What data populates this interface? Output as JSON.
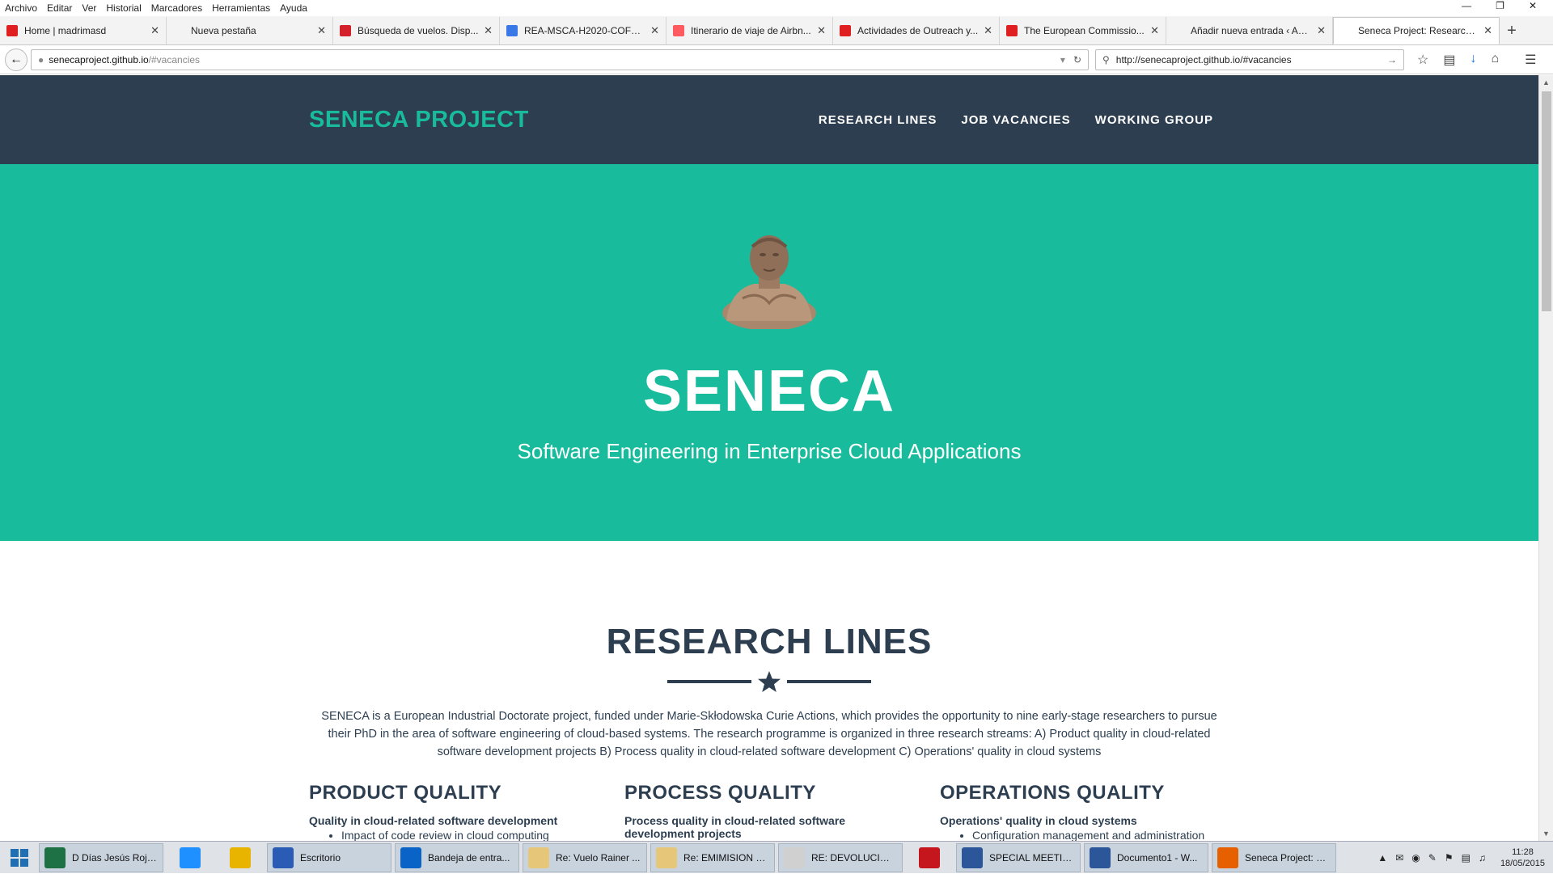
{
  "menu": [
    "Archivo",
    "Editar",
    "Ver",
    "Historial",
    "Marcadores",
    "Herramientas",
    "Ayuda"
  ],
  "tabs": [
    {
      "title": "Home | madrimasd",
      "icon": "madrimasd-icon",
      "color": "#e02020"
    },
    {
      "title": "Nueva pestaña",
      "icon": "blank-icon",
      "color": "#f3f3f3"
    },
    {
      "title": "Búsqueda de vuelos. Disp...",
      "icon": "iberia-icon",
      "color": "#d4202a"
    },
    {
      "title": "REA-MSCA-H2020-COFU...",
      "icon": "google-icon",
      "color": "#3b78e7"
    },
    {
      "title": "Itinerario de viaje de Airbn...",
      "icon": "airbnb-icon",
      "color": "#ff5a5f"
    },
    {
      "title": "Actividades de Outreach y...",
      "icon": "madrimasd-icon",
      "color": "#e02020"
    },
    {
      "title": "The European Commissio...",
      "icon": "madrimasd-icon",
      "color": "#e02020"
    },
    {
      "title": "Añadir nueva entrada ‹ Accion...",
      "icon": "blank-icon",
      "color": "#f3f3f3"
    },
    {
      "title": "Seneca Project: Research on Cl...",
      "icon": "blank-icon",
      "color": "#ffffff",
      "active": true
    }
  ],
  "address": {
    "host": "senecaproject.github.io",
    "path": "/#vacancies"
  },
  "search": {
    "value": "http://senecaproject.github.io/#vacancies"
  },
  "site": {
    "brand": "SENECA PROJECT",
    "nav": [
      "RESEARCH LINES",
      "JOB VACANCIES",
      "WORKING GROUP"
    ],
    "hero_title": "SENECA",
    "hero_subtitle": "Software Engineering in Enterprise Cloud Applications",
    "research_title": "RESEARCH LINES",
    "intro": "SENECA is a European Industrial Doctorate project, funded under Marie-Skłodowska Curie Actions, which provides the opportunity to nine early-stage researchers to pursue their PhD in the area of software engineering of cloud-based systems. The research programme is organized in three research streams: A) Product quality in cloud-related software development projects B) Process quality in cloud-related software development C) Operations' quality in cloud systems",
    "columns": [
      {
        "title": "PRODUCT QUALITY",
        "subtitle": "Quality in cloud-related software development",
        "item": "Impact of code review in cloud computing"
      },
      {
        "title": "PROCESS QUALITY",
        "subtitle": "Process quality in cloud-related software development projects",
        "item": ""
      },
      {
        "title": "OPERATIONS QUALITY",
        "subtitle": "Operations' quality in cloud systems",
        "item": "Configuration management and administration"
      }
    ]
  },
  "taskbar": [
    {
      "label": "D Días Jesús Rojo...",
      "icon": "excel-icon",
      "color": "#1e7145",
      "wide": true
    },
    {
      "label": "",
      "icon": "ie-icon",
      "color": "#1e90ff",
      "wide": false
    },
    {
      "label": "",
      "icon": "chrome-icon",
      "color": "#e8b400",
      "wide": false
    },
    {
      "label": "Escritorio",
      "icon": "desktop-icon",
      "color": "#2a5bb5",
      "wide": true
    },
    {
      "label": "Bandeja de entra...",
      "icon": "outlook-icon",
      "color": "#0a64c8",
      "wide": true
    },
    {
      "label": "Re: Vuelo Rainer ...",
      "icon": "mail-icon",
      "color": "#e6c77a",
      "wide": true
    },
    {
      "label": "Re: EMIMISION B...",
      "icon": "mail-icon",
      "color": "#e6c77a",
      "wide": true
    },
    {
      "label": "RE: DEVOLUCIÓN...",
      "icon": "mail-icon",
      "color": "#d0d0d0",
      "wide": true
    },
    {
      "label": "",
      "icon": "pdf-icon",
      "color": "#c4161c",
      "wide": false
    },
    {
      "label": "SPECIAL MEETIN...",
      "icon": "word-icon",
      "color": "#2b579a",
      "wide": true
    },
    {
      "label": "Documento1 - W...",
      "icon": "word-icon",
      "color": "#2b579a",
      "wide": true
    },
    {
      "label": "Seneca Project: R...",
      "icon": "firefox-icon",
      "color": "#e66000",
      "wide": true
    }
  ],
  "clock": {
    "time": "11:28",
    "date": "18/05/2015"
  },
  "colors": {
    "nav": "#2c3e50",
    "accent": "#18bc9c"
  }
}
